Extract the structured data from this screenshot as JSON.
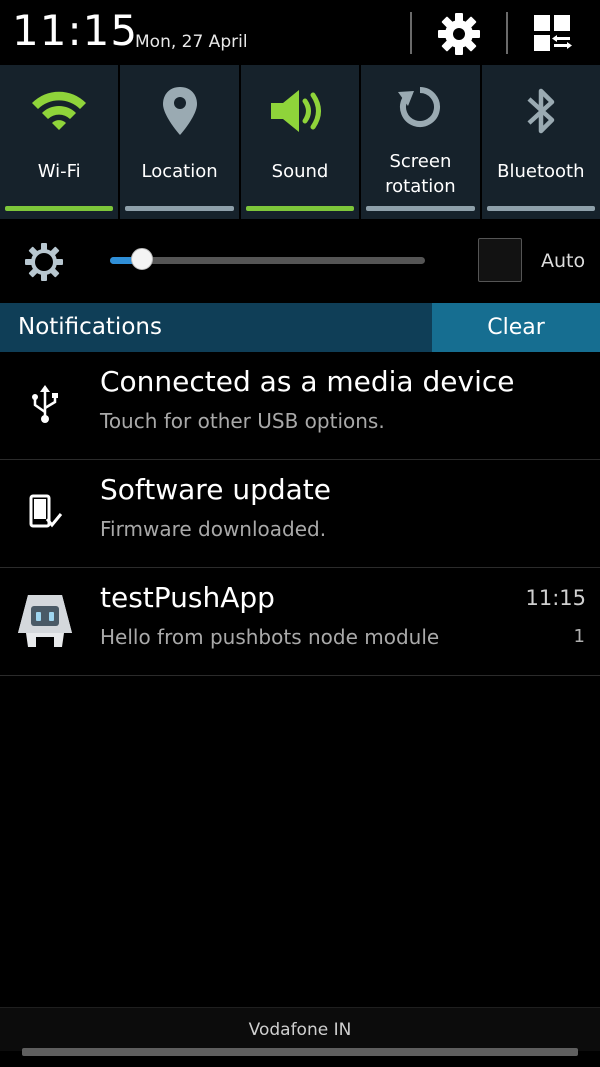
{
  "status": {
    "time": "11:15",
    "date": "Mon, 27 April"
  },
  "quick_toggles": [
    {
      "label": "Wi-Fi",
      "icon": "wifi-icon",
      "active": true
    },
    {
      "label": "Location",
      "icon": "location-pin-icon",
      "active": false
    },
    {
      "label": "Sound",
      "icon": "speaker-icon",
      "active": true
    },
    {
      "label_line1": "Screen",
      "label_line2": "rotation",
      "icon": "rotate-icon",
      "active": false
    },
    {
      "label": "Bluetooth",
      "icon": "bluetooth-icon",
      "active": false
    }
  ],
  "brightness": {
    "level": 0.1,
    "auto_label": "Auto",
    "auto_checked": false
  },
  "notifications_header": {
    "title": "Notifications",
    "clear_label": "Clear"
  },
  "notifications": [
    {
      "title": "Connected as a media device",
      "subtitle": "Touch for other USB options.",
      "icon": "usb-icon"
    },
    {
      "title": "Software update",
      "subtitle": "Firmware downloaded.",
      "icon": "phone-check-icon"
    },
    {
      "title": "testPushApp",
      "subtitle": "Hello from pushbots node module",
      "time": "11:15",
      "count": "1",
      "icon": "cordova-app-icon"
    }
  ],
  "carrier": "Vodafone IN",
  "colors": {
    "accent_green": "#7dc63a",
    "notif_header": "#0f3e57",
    "clear_button": "#166e91",
    "slider_blue": "#2f8fd8"
  }
}
